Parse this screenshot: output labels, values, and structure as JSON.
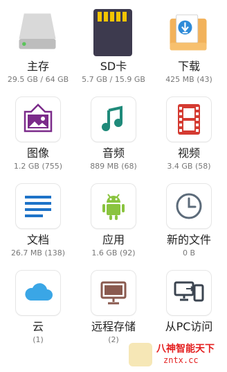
{
  "items": [
    {
      "id": "internal",
      "label": "主存",
      "sub": "29.5 GB / 64 GB",
      "icon": "hard-drive-icon"
    },
    {
      "id": "sd",
      "label": "SD卡",
      "sub": "5.7 GB / 15.9 GB",
      "icon": "sd-card-icon"
    },
    {
      "id": "download",
      "label": "下载",
      "sub": "425 MB (43)",
      "icon": "download-folder-icon"
    },
    {
      "id": "images",
      "label": "图像",
      "sub": "1.2 GB (755)",
      "icon": "image-frame-icon"
    },
    {
      "id": "audio",
      "label": "音频",
      "sub": "889 MB (68)",
      "icon": "music-note-icon"
    },
    {
      "id": "video",
      "label": "视频",
      "sub": "3.4 GB (58)",
      "icon": "film-icon"
    },
    {
      "id": "documents",
      "label": "文档",
      "sub": "26.7 MB (138)",
      "icon": "document-lines-icon"
    },
    {
      "id": "apps",
      "label": "应用",
      "sub": "1.6 GB (92)",
      "icon": "android-icon"
    },
    {
      "id": "recent",
      "label": "新的文件",
      "sub": "0 B",
      "icon": "clock-icon"
    },
    {
      "id": "cloud",
      "label": "云",
      "sub": "(1)",
      "icon": "cloud-icon"
    },
    {
      "id": "remote",
      "label": "远程存储",
      "sub": "(2)",
      "icon": "monitor-icon"
    },
    {
      "id": "pc",
      "label": "从PC访问",
      "sub": "",
      "icon": "pc-transfer-icon"
    }
  ],
  "watermark": {
    "title": "八神智能天下",
    "url": "zntx.cc"
  },
  "colors": {
    "purple": "#7b2b8a",
    "teal": "#1f8a7a",
    "red": "#d43b32",
    "blue": "#1e73c8",
    "android": "#8ac43f",
    "slate": "#5c6b7a",
    "sky": "#3aa6e6",
    "brown": "#8a5a4f",
    "dark": "#3b4450"
  }
}
